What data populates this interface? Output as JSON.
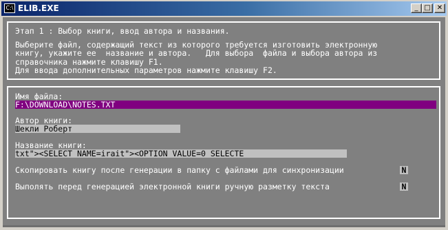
{
  "window": {
    "title": "ELIB.EXE",
    "icon": "console-icon",
    "icon_text": "C:\\",
    "controls": {
      "minimize": "_",
      "maximize": "□",
      "close": "✕"
    }
  },
  "header": {
    "stage_title": "Этап 1 : Выбор книги, ввод автора и названия.",
    "instructions": [
      "Выберите файл, содержащий текст из которого требуется изготовить электронную",
      "книгу, укажите ее  название и автора.   Для выбора  файла и выбора автора из",
      "справочника нажмите клавишу F1.",
      "Для ввода дополнительных параметров нажмите клавишу F2."
    ]
  },
  "form": {
    "file": {
      "label": "Имя файла:",
      "value": "F:\\DOWNLOAD\\NOTES.TXT"
    },
    "author": {
      "label": "Автор книги:",
      "value": "Шекли Роберт"
    },
    "title": {
      "label": "Название книги:",
      "value": "txt\"><SELECT NAME=irait\"><OPTION VALUE=0 SELECTE"
    },
    "option_copy": {
      "label": "Скопировать книгу после генерации в папку с файлами для синхронизации",
      "value": "N"
    },
    "option_markup": {
      "label": "Выполять перед генерацией электронной книги ручную разметку текста",
      "value": "N"
    }
  },
  "colors": {
    "console_bg": "#808080",
    "text": "#ffffff",
    "field_bg": "#c0c0c0",
    "selected_field_bg": "#800080",
    "title_bar": "#0a246a"
  }
}
